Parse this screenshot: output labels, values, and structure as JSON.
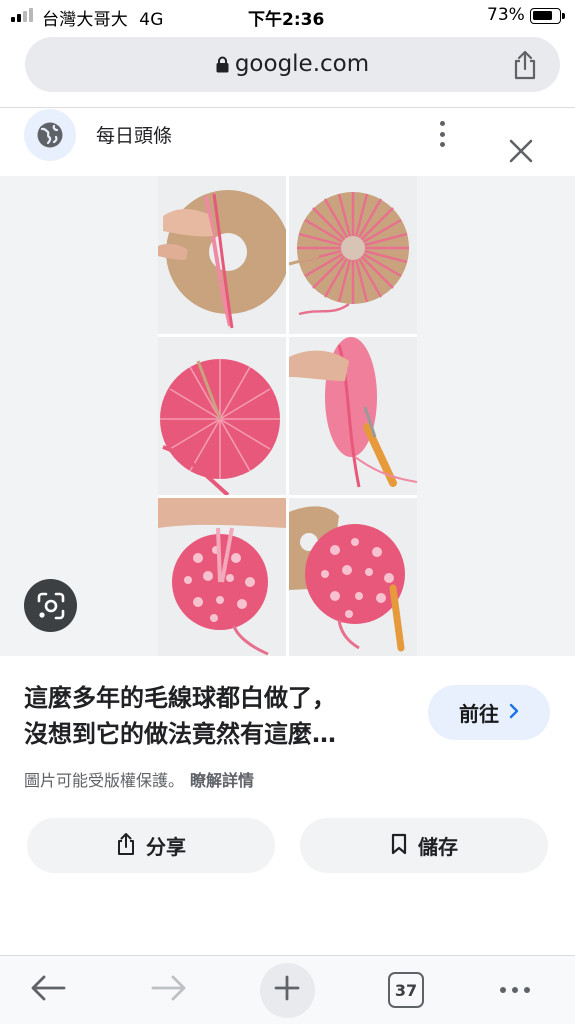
{
  "status_bar": {
    "carrier": "台灣大哥大",
    "network": "4G",
    "time": "下午2:36",
    "battery": "73%",
    "battery_level": 0.73
  },
  "browser": {
    "url": "google.com",
    "lock_icon": "lock-icon",
    "share_icon": "share-icon"
  },
  "source": {
    "name": "每日頭條",
    "icon": "globe-icon"
  },
  "image": {
    "description_icon": "lens-icon"
  },
  "result": {
    "title_line1": "這麼多年的毛線球都白做了，",
    "title_line2": "沒想到它的做法竟然有這麼…",
    "visit_label": "前往",
    "copyright_text": "圖片可能受版權保護。",
    "learn_more": "瞭解詳情"
  },
  "actions": {
    "share_label": "分享",
    "save_label": "儲存"
  },
  "toolbar": {
    "tab_count": "37"
  },
  "colors": {
    "accent_light": "#e8f0fe",
    "pink_yarn": "#e8587a",
    "cardboard": "#c9a27e"
  }
}
